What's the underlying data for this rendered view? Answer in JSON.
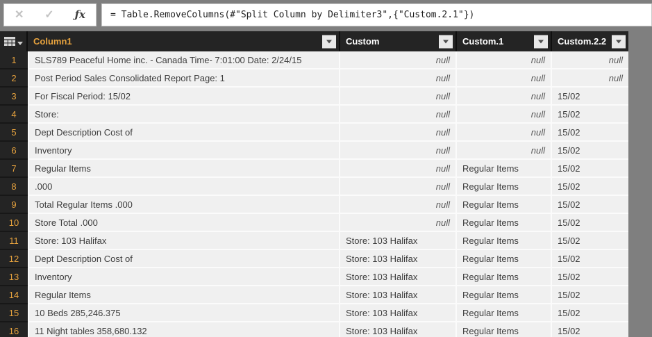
{
  "formula_bar": {
    "cancel_icon": "✕",
    "check_icon": "✓",
    "fx_icon": "ƒx",
    "formula": "= Table.RemoveColumns(#\"Split Column by Delimiter3\",{\"Custom.2.1\"})"
  },
  "table": {
    "columns": [
      {
        "label": "Column1",
        "selected": true
      },
      {
        "label": "Custom",
        "selected": false
      },
      {
        "label": "Custom.1",
        "selected": false
      },
      {
        "label": "Custom.2.2",
        "selected": false
      }
    ],
    "rows": [
      {
        "num": "1",
        "cells": [
          "SLS789 Peaceful Home inc. - Canada Time- 7:01:00 Date: 2/24/15",
          "null",
          "null",
          "null"
        ]
      },
      {
        "num": "2",
        "cells": [
          "Post Period Sales Consolidated Report Page: 1",
          "null",
          "null",
          "null"
        ]
      },
      {
        "num": "3",
        "cells": [
          "For Fiscal Period: 15/02",
          "null",
          "null",
          "15/02"
        ]
      },
      {
        "num": "4",
        "cells": [
          "Store:",
          "null",
          "null",
          "15/02"
        ]
      },
      {
        "num": "5",
        "cells": [
          "Dept Description Cost of",
          "null",
          "null",
          "15/02"
        ]
      },
      {
        "num": "6",
        "cells": [
          "Inventory",
          "null",
          "null",
          "15/02"
        ]
      },
      {
        "num": "7",
        "cells": [
          "Regular Items",
          "null",
          "Regular Items",
          "15/02"
        ]
      },
      {
        "num": "8",
        "cells": [
          ".000",
          "null",
          "Regular Items",
          "15/02"
        ]
      },
      {
        "num": "9",
        "cells": [
          "Total Regular Items .000",
          "null",
          "Regular Items",
          "15/02"
        ]
      },
      {
        "num": "10",
        "cells": [
          "Store Total .000",
          "null",
          "Regular Items",
          "15/02"
        ]
      },
      {
        "num": "11",
        "cells": [
          "Store: 103 Halifax",
          "Store: 103 Halifax",
          "Regular Items",
          "15/02"
        ]
      },
      {
        "num": "12",
        "cells": [
          "Dept Description Cost of",
          "Store: 103 Halifax",
          "Regular Items",
          "15/02"
        ]
      },
      {
        "num": "13",
        "cells": [
          "Inventory",
          "Store: 103 Halifax",
          "Regular Items",
          "15/02"
        ]
      },
      {
        "num": "14",
        "cells": [
          "Regular Items",
          "Store: 103 Halifax",
          "Regular Items",
          "15/02"
        ]
      },
      {
        "num": "15",
        "cells": [
          "10 Beds 285,246.375",
          "Store: 103 Halifax",
          "Regular Items",
          "15/02"
        ]
      },
      {
        "num": "16",
        "cells": [
          "11 Night tables 358,680.132",
          "Store: 103 Halifax",
          "Regular Items",
          "15/02"
        ]
      }
    ]
  },
  "colors": {
    "header_bg": "#242424",
    "accent_gold": "#E8A33E",
    "cell_bg": "#F0F0F0",
    "cell_text": "#3C3C3C",
    "null_text": "#5A5A5A",
    "outer_gray": "#7F7F7F"
  }
}
